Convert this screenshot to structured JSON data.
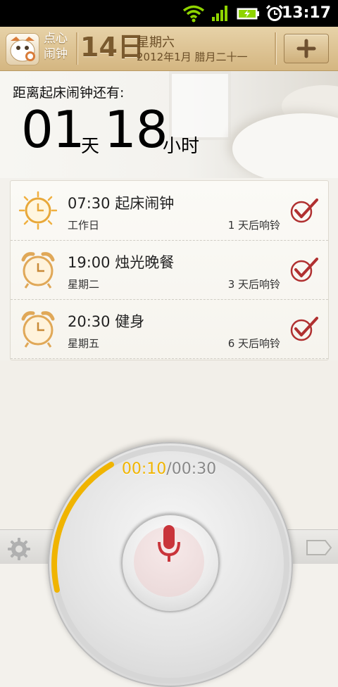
{
  "status_bar": {
    "time": "13:17",
    "icons": [
      "wifi-icon",
      "signal-icon",
      "battery-charging-icon",
      "alarm-clock-icon"
    ]
  },
  "header": {
    "app_name": "点心闹钟",
    "day": "14日",
    "weekday": "星期六",
    "date": "2012年1月 腊月二十一",
    "add_button_icon": "plus-icon"
  },
  "countdown": {
    "label": "距离起床闹钟还有:",
    "days": "01",
    "days_unit": "天",
    "hours": "18",
    "hours_unit": "小时"
  },
  "alarms": [
    {
      "time": "07:30",
      "name": "起床闹钟",
      "title": "07:30 起床闹钟",
      "repeat": "工作日",
      "next": "1 天后响铃",
      "enabled": true
    },
    {
      "time": "19:00",
      "name": "烛光晚餐",
      "title": "19:00 烛光晚餐",
      "repeat": "星期二",
      "next": "3 天后响铃",
      "enabled": true
    },
    {
      "time": "20:30",
      "name": "健身",
      "title": "20:30 健身",
      "repeat": "星期五",
      "next": "6 天后响铃",
      "enabled": true
    }
  ],
  "recorder": {
    "elapsed": "00:10",
    "separator": "/",
    "total": "00:30",
    "progress": 0.333,
    "mic_icon": "microphone-icon"
  },
  "bottom_bar": {
    "left_icon": "settings-gear-icon",
    "right_icon": "tag-icon"
  },
  "colors": {
    "header": "#d9be8c",
    "accent_progress": "#f0b400",
    "check_red": "#b03030",
    "mic_red": "#c9343a"
  }
}
